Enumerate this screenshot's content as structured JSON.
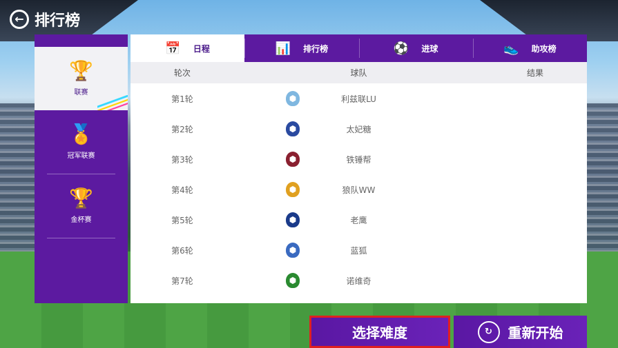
{
  "header": {
    "title": "排行榜",
    "back_icon": "back-arrow-icon"
  },
  "sidebar": {
    "items": [
      {
        "label": "联赛",
        "icon": "trophy-icon",
        "active": true
      },
      {
        "label": "冠军联赛",
        "icon": "medal-icon",
        "active": false
      },
      {
        "label": "金杯赛",
        "icon": "cup-icon",
        "active": false
      }
    ]
  },
  "tabs": [
    {
      "label": "日程",
      "icon": "calendar-icon",
      "active": true
    },
    {
      "label": "排行榜",
      "icon": "bar-chart-icon",
      "active": false
    },
    {
      "label": "进球",
      "icon": "soccer-ball-icon",
      "active": false
    },
    {
      "label": "助攻榜",
      "icon": "boot-icon",
      "active": false
    }
  ],
  "table": {
    "columns": [
      "轮次",
      "球队",
      "结果"
    ],
    "rows": [
      {
        "round": "第1轮",
        "team": "利兹联LU",
        "result": "",
        "badge_color": "#7fb7e0"
      },
      {
        "round": "第2轮",
        "team": "太妃糖",
        "result": "",
        "badge_color": "#2a4aa0"
      },
      {
        "round": "第3轮",
        "team": "铁锤帮",
        "result": "",
        "badge_color": "#8a2030"
      },
      {
        "round": "第4轮",
        "team": "狼队WW",
        "result": "",
        "badge_color": "#e0a020"
      },
      {
        "round": "第5轮",
        "team": "老鹰",
        "result": "",
        "badge_color": "#1a3a8a"
      },
      {
        "round": "第6轮",
        "team": "蓝狐",
        "result": "",
        "badge_color": "#3a6ac0"
      },
      {
        "round": "第7轮",
        "team": "诺维奇",
        "result": "",
        "badge_color": "#2a8a30"
      }
    ]
  },
  "buttons": {
    "select_difficulty": "选择难度",
    "restart": "重新开始"
  },
  "colors": {
    "accent": "#5c1aa0",
    "highlight_border": "#e02020"
  }
}
